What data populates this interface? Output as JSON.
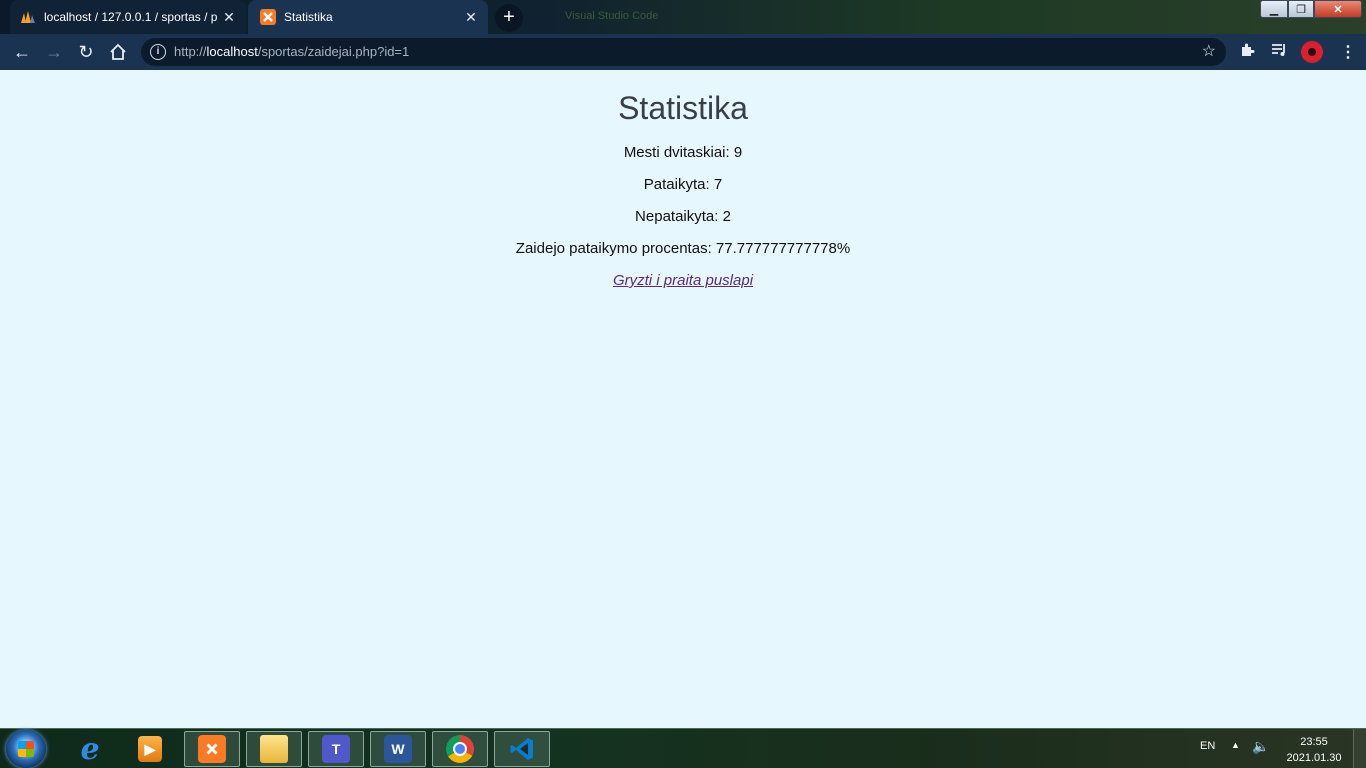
{
  "browser": {
    "tabs": [
      {
        "title": "localhost / 127.0.0.1 / sportas / p",
        "favicon": "phpmyadmin-icon",
        "active": false
      },
      {
        "title": "Statistika",
        "favicon": "xampp-icon",
        "active": true
      }
    ],
    "address": {
      "url_prefix": "http://",
      "url_host": "localhost",
      "url_path": "/sportas/zaidejai.php?id=1"
    },
    "background_window_title": "Visual Studio Code"
  },
  "page": {
    "title": "Statistika",
    "stats": [
      "Mesti dvitaskiai: 9",
      "Pataikyta: 7",
      "Nepataikyta: 2",
      "Zaidejo pataikymo procentas: 77.777777777778%"
    ],
    "back_link": "Gryzti i praita puslapi",
    "background_color": "#e6f7fd"
  },
  "taskbar": {
    "apps": [
      "internet-explorer-icon",
      "media-player-icon",
      "xampp-icon",
      "file-explorer-icon",
      "teams-icon",
      "word-icon",
      "chrome-icon",
      "vscode-icon"
    ],
    "language": "EN",
    "time": "23:55",
    "date": "2021.01.30"
  }
}
